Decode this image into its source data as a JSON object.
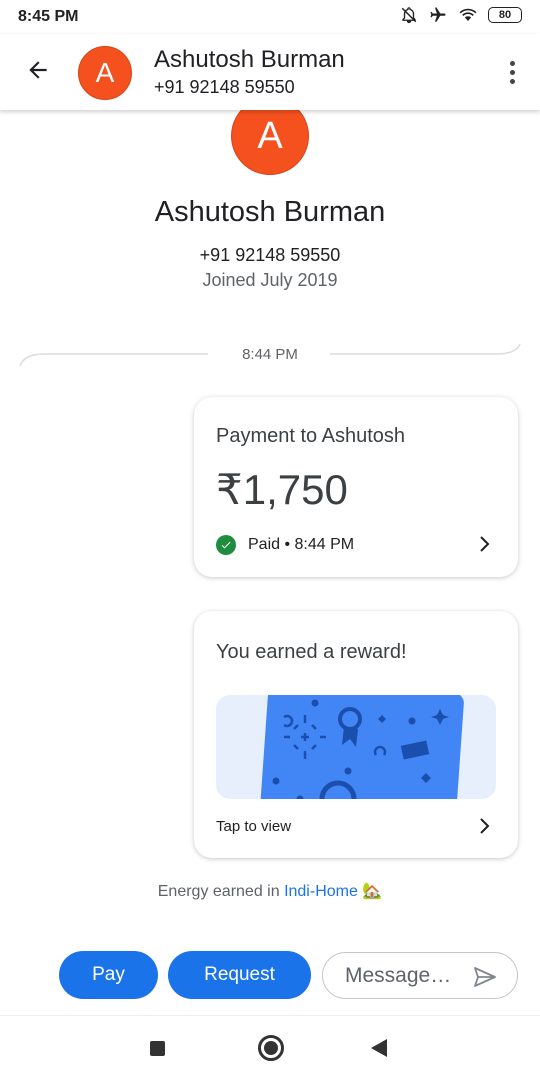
{
  "status_bar": {
    "time": "8:45 PM",
    "battery": "80",
    "icons": [
      "notifications-off-icon",
      "airplane-icon",
      "wifi-icon",
      "battery-icon"
    ]
  },
  "header": {
    "avatar_letter": "A",
    "name": "Ashutosh Burman",
    "phone": "+91 92148 59550",
    "icons": [
      "back-arrow-icon",
      "more-vert-icon"
    ]
  },
  "profile": {
    "avatar_letter": "A",
    "name": "Ashutosh Burman",
    "phone": "+91 92148 59550",
    "joined": "Joined July 2019"
  },
  "timeline": {
    "divider_time": "8:44 PM"
  },
  "payment_card": {
    "title": "Payment to Ashutosh",
    "amount": "₹1,750",
    "status": "Paid • 8:44 PM",
    "icons": [
      "check-circle-icon",
      "chevron-right-icon"
    ]
  },
  "reward_card": {
    "title": "You earned a reward!",
    "action": "Tap to view",
    "icons": [
      "scratch-card-icon",
      "chevron-right-icon"
    ]
  },
  "energy": {
    "prefix": "Energy earned in ",
    "link": "Indi-Home",
    "emoji": "🏡"
  },
  "actions": {
    "pay_label": "Pay",
    "request_label": "Request",
    "message_placeholder": "Message…"
  },
  "nav_bar": {
    "icons": [
      "recents-icon",
      "home-icon",
      "back-icon"
    ]
  },
  "colors": {
    "avatar": "#f4511e",
    "primary": "#1a73e8",
    "success": "#1e8e3e",
    "reward_card": "#4285f4",
    "reward_bg": "#e8effc"
  }
}
